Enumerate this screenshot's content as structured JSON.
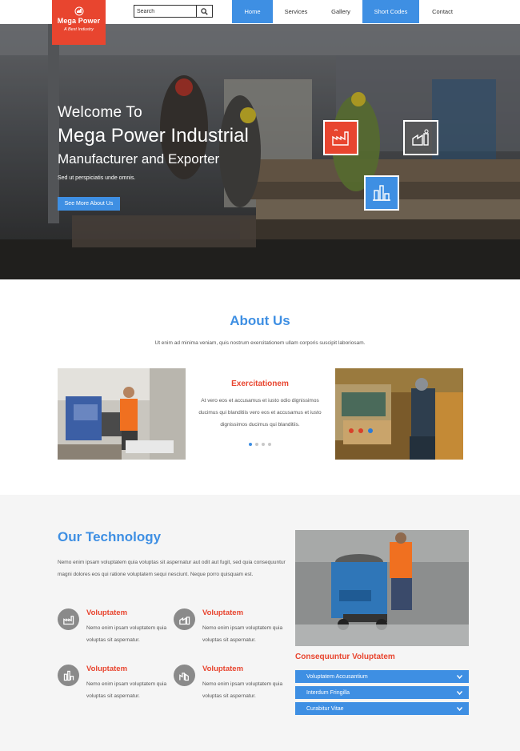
{
  "brand": {
    "name": "Mega Power",
    "tagline": "A Best Industry"
  },
  "search": {
    "placeholder": "Search"
  },
  "nav": [
    {
      "label": "Home",
      "active": true
    },
    {
      "label": "Services",
      "active": false
    },
    {
      "label": "Gallery",
      "active": false
    },
    {
      "label": "Short Codes",
      "active": true
    },
    {
      "label": "Contact",
      "active": false
    }
  ],
  "hero": {
    "welcome": "Welcome To",
    "title": "Mega Power Industrial",
    "subtitle": "Manufacturer and Exporter",
    "small": "Sed ut perspiciatis unde omnis.",
    "button": "See More About Us",
    "icons": [
      "factory-icon",
      "industry-icon",
      "refinery-icon"
    ]
  },
  "about": {
    "title": "About Us",
    "text": "Ut enim ad minima veniam, quis nostrum exercitationem ullam corporis suscipit laboriosam.",
    "center_title": "Exercitationem",
    "center_text": "At vero eos et accusamus et iusto odio dignissimos ducimus qui blanditiis vero eos et accusamus et iusto dignissimos ducimus qui blanditiis.",
    "slider_dots": 4,
    "active_dot": 0
  },
  "technology": {
    "title": "Our Technology",
    "text": "Nemo enim ipsam voluptatem quia voluptas sit aspernatur aut odit aut fugit, sed quia consequuntur magni dolores eos qui ratione voluptatem sequi nesciunt. Neque porro quisquam est.",
    "features": [
      {
        "title": "Voluptatem",
        "text": "Nemo enim ipsam voluptatem quia voluptas sit aspernatur.",
        "icon": "factory-icon"
      },
      {
        "title": "Voluptatem",
        "text": "Nemo enim ipsam voluptatem quia voluptas sit aspernatur.",
        "icon": "industry-icon"
      },
      {
        "title": "Voluptatem",
        "text": "Nemo enim ipsam voluptatem quia voluptas sit aspernatur.",
        "icon": "refinery-icon"
      },
      {
        "title": "Voluptatem",
        "text": "Nemo enim ipsam voluptatem quia voluptas sit aspernatur.",
        "icon": "plant-icon"
      }
    ],
    "accordion_title": "Consequuntur Voluptatem",
    "accordion": [
      "Voluptatem Accusantium",
      "Interdum Fringilla",
      "Curabitur Vitae"
    ]
  },
  "colors": {
    "accent": "#3e8fe3",
    "brand": "#e8452f",
    "section_bg": "#f5f5f5"
  }
}
